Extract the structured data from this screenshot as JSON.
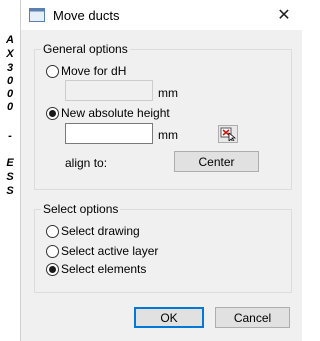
{
  "side_strip": [
    "A",
    "X",
    "3",
    "0",
    "0",
    "0",
    "-",
    "E",
    "S",
    "S"
  ],
  "window": {
    "title": "Move ducts",
    "close_glyph": "✕"
  },
  "general_options": {
    "legend": "General options",
    "move_for_dh": {
      "label": "Move for dH",
      "selected": false,
      "value": "",
      "unit": "mm"
    },
    "new_absolute_height": {
      "label": "New absolute height",
      "selected": true,
      "value": "",
      "unit": "mm"
    },
    "pick_icon": "pick-height-icon",
    "align_to_label": "align to:",
    "align_button_label": "Center"
  },
  "select_options": {
    "legend": "Select options",
    "options": [
      {
        "label": "Select drawing",
        "selected": false
      },
      {
        "label": "Select active layer",
        "selected": false
      },
      {
        "label": "Select elements",
        "selected": true
      }
    ]
  },
  "footer": {
    "ok_label": "OK",
    "cancel_label": "Cancel"
  },
  "colors": {
    "accent": "#0078d7",
    "dialog_bg": "#f0f0f0",
    "pick_icon_red": "#d01010"
  }
}
